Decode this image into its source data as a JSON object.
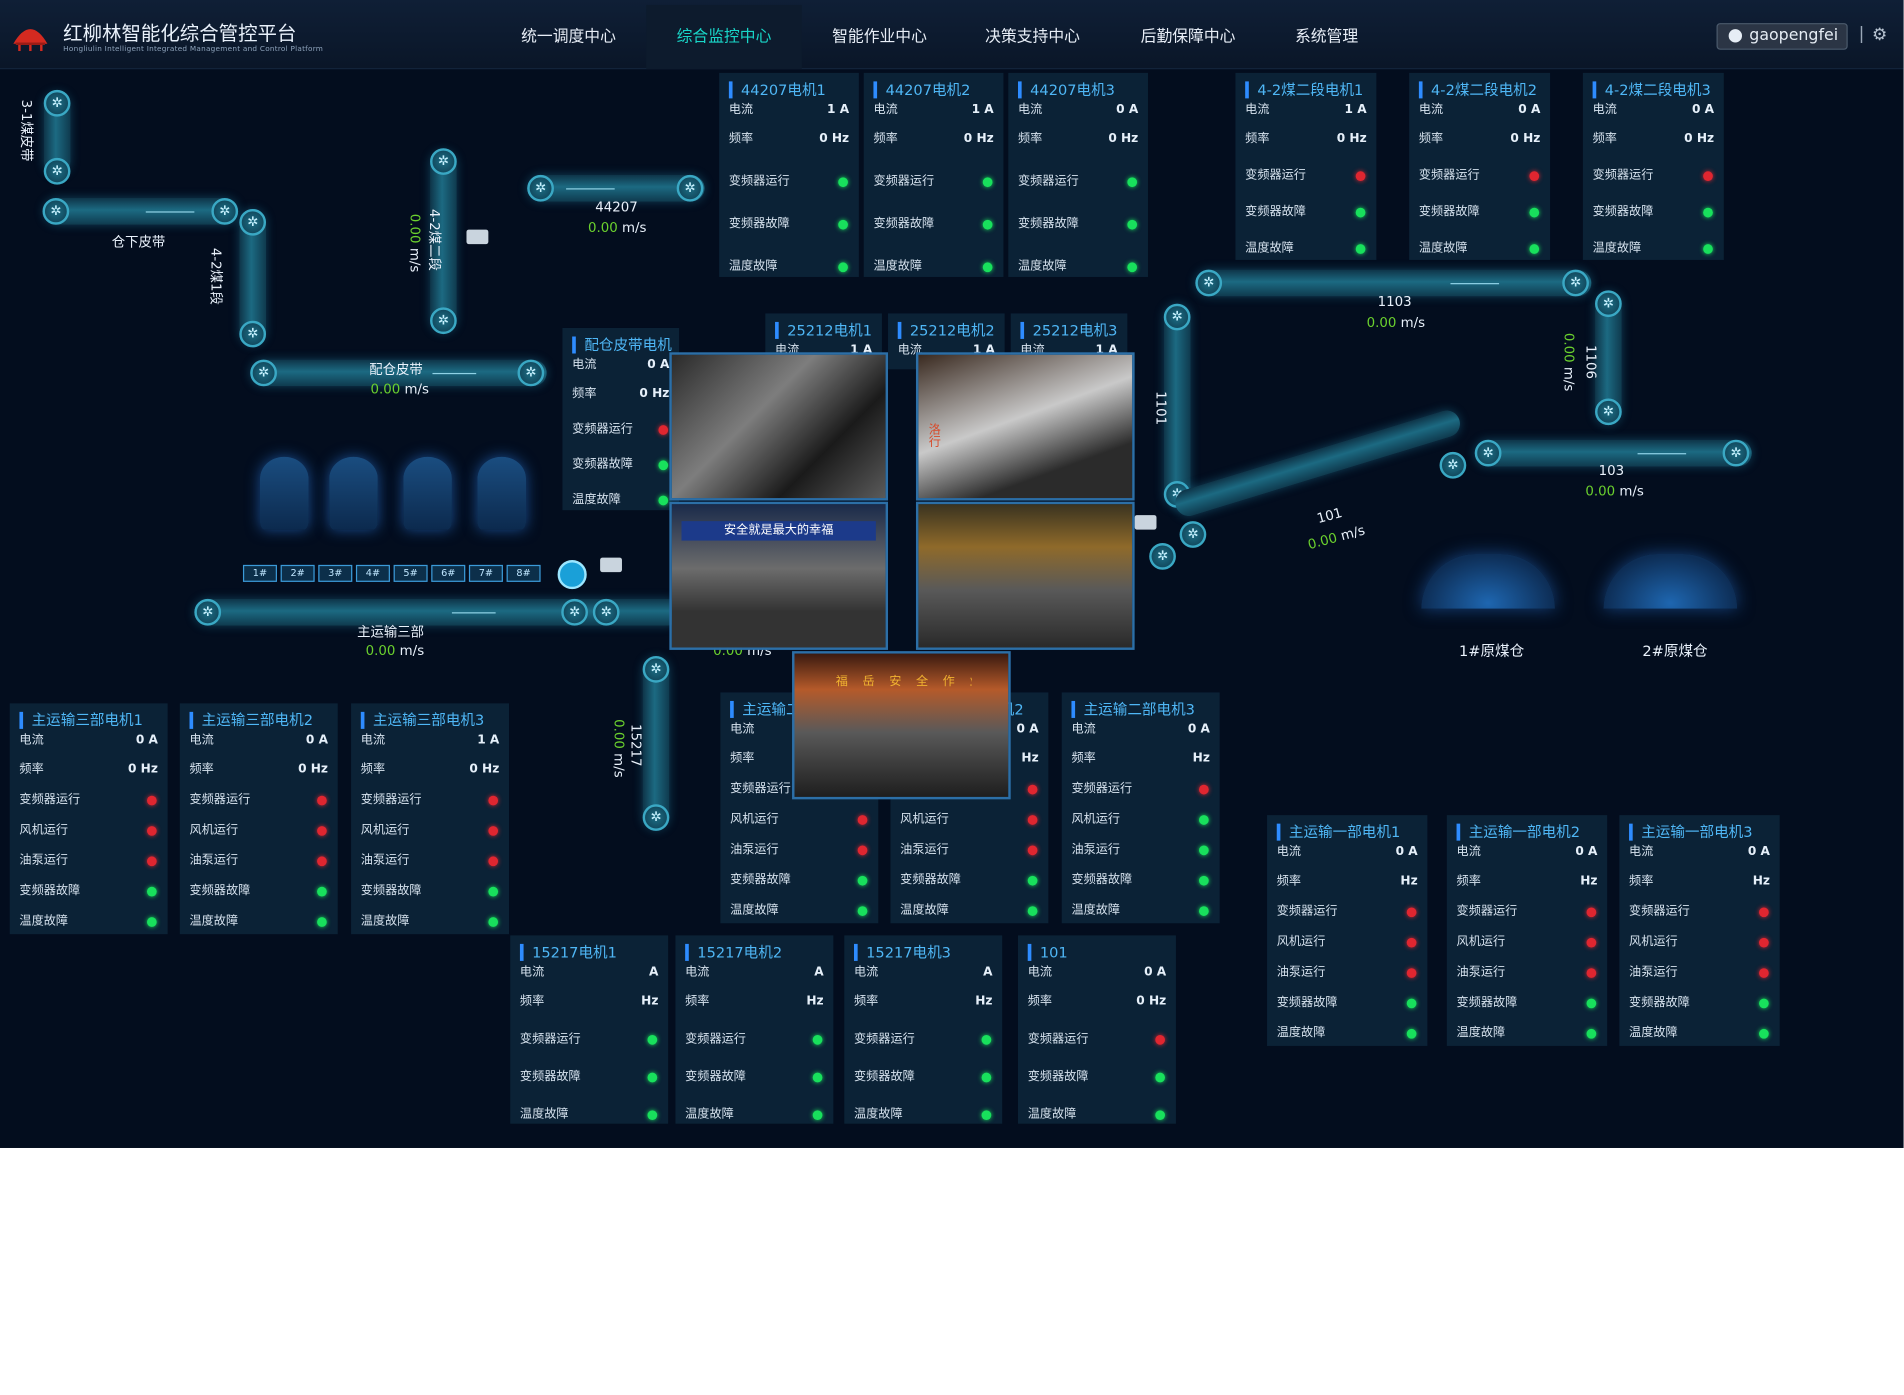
{
  "header": {
    "title": "红柳林智能化综合管控平台",
    "subtitle": "Hongliulin Intelligent Integrated Management and Control Platform",
    "nav": [
      {
        "label": "统一调度中心",
        "active": false
      },
      {
        "label": "综合监控中心",
        "active": true
      },
      {
        "label": "智能作业中心",
        "active": false
      },
      {
        "label": "决策支持中心",
        "active": false
      },
      {
        "label": "后勤保障中心",
        "active": false
      },
      {
        "label": "系统管理",
        "active": false
      }
    ],
    "user": "gaopengfei",
    "separator": "|",
    "settings_icon": "gear-icon"
  },
  "labels": {
    "current": "电流",
    "freq": "频率",
    "vfd_run": "变频器运行",
    "fan_run": "风机运行",
    "pump_run": "油泵运行",
    "vfd_fault": "变频器故障",
    "temp_fault": "温度故障"
  },
  "colors": {
    "ok": "#18e05c",
    "alarm": "#e02630",
    "accent": "#4fb7f6",
    "active_nav": "#19d6c8"
  },
  "belts": {
    "b31": {
      "label": "3-1煤皮带"
    },
    "cangxia": {
      "label": "仓下皮带"
    },
    "b421": {
      "label": "4-2煤1段"
    },
    "b422": {
      "label": "4-2煤二段",
      "speed": "0.00",
      "unit": "m/s"
    },
    "b44207": {
      "label": "44207",
      "speed": "0.00",
      "unit": "m/s"
    },
    "peicang": {
      "label": "配仓皮带",
      "speed": "0.00",
      "unit": "m/s"
    },
    "main3": {
      "label": "主运输三部",
      "speed": "0.00",
      "unit": "m/s"
    },
    "b15217": {
      "label": "15217",
      "speed": "0.00",
      "unit": "m/s"
    },
    "b1103": {
      "label": "1103",
      "speed": "0.00",
      "unit": "m/s"
    },
    "b1101": {
      "label": "1101",
      "speed": "0.00",
      "unit": "m/s"
    },
    "b1106": {
      "label": "1106",
      "speed": "0.00",
      "unit": "m/s"
    },
    "b103": {
      "label": "103",
      "speed": "0.00",
      "unit": "m/s"
    },
    "b101": {
      "label": "101",
      "speed": "0.00",
      "unit": "m/s"
    },
    "hidden_speed": {
      "speed": "0.00",
      "unit": "m/s"
    }
  },
  "bins": [
    "1#",
    "2#",
    "3#",
    "4#",
    "5#",
    "6#",
    "7#",
    "8#"
  ],
  "silos": {
    "s1": "1#原煤仓",
    "s2": "2#原煤仓"
  },
  "cards": [
    {
      "id": "c44207a",
      "title": "44207电机1",
      "current": "1 A",
      "freq": "0 Hz",
      "status": [
        [
          "vfd_run",
          "g"
        ],
        [
          "vfd_fault",
          "g"
        ],
        [
          "temp_fault",
          "g"
        ]
      ]
    },
    {
      "id": "c44207b",
      "title": "44207电机2",
      "current": "1 A",
      "freq": "0 Hz",
      "status": [
        [
          "vfd_run",
          "g"
        ],
        [
          "vfd_fault",
          "g"
        ],
        [
          "temp_fault",
          "g"
        ]
      ]
    },
    {
      "id": "c44207c",
      "title": "44207电机3",
      "current": "0 A",
      "freq": "0 Hz",
      "status": [
        [
          "vfd_run",
          "g"
        ],
        [
          "vfd_fault",
          "g"
        ],
        [
          "temp_fault",
          "g"
        ]
      ]
    },
    {
      "id": "c42a",
      "title": "4-2煤二段电机1",
      "current": "1 A",
      "freq": "0 Hz",
      "status": [
        [
          "vfd_run",
          "r"
        ],
        [
          "vfd_fault",
          "g"
        ],
        [
          "temp_fault",
          "g"
        ]
      ]
    },
    {
      "id": "c42b",
      "title": "4-2煤二段电机2",
      "current": "0 A",
      "freq": "0 Hz",
      "status": [
        [
          "vfd_run",
          "r"
        ],
        [
          "vfd_fault",
          "g"
        ],
        [
          "temp_fault",
          "g"
        ]
      ]
    },
    {
      "id": "c42c",
      "title": "4-2煤二段电机3",
      "current": "0 A",
      "freq": "0 Hz",
      "status": [
        [
          "vfd_run",
          "r"
        ],
        [
          "vfd_fault",
          "g"
        ],
        [
          "temp_fault",
          "g"
        ]
      ]
    },
    {
      "id": "cpc",
      "title": "配仓皮带电机",
      "current": "0 A",
      "freq": "0 Hz",
      "status": [
        [
          "vfd_run",
          "r"
        ],
        [
          "vfd_fault",
          "g"
        ],
        [
          "temp_fault",
          "g"
        ]
      ]
    },
    {
      "id": "c25a",
      "title": "25212电机1",
      "current": "1 A",
      "freq": "",
      "status": []
    },
    {
      "id": "c25b",
      "title": "25212电机2",
      "current": "1 A",
      "freq": "",
      "status": []
    },
    {
      "id": "c25c",
      "title": "25212电机3",
      "current": "1 A",
      "freq": "",
      "status": []
    },
    {
      "id": "cm3a",
      "title": "主运输三部电机1",
      "current": "0 A",
      "freq": "0 Hz",
      "status": [
        [
          "vfd_run",
          "r"
        ],
        [
          "fan_run",
          "r"
        ],
        [
          "pump_run",
          "r"
        ],
        [
          "vfd_fault",
          "g"
        ],
        [
          "temp_fault",
          "g"
        ]
      ]
    },
    {
      "id": "cm3b",
      "title": "主运输三部电机2",
      "current": "0 A",
      "freq": "0 Hz",
      "status": [
        [
          "vfd_run",
          "r"
        ],
        [
          "fan_run",
          "r"
        ],
        [
          "pump_run",
          "r"
        ],
        [
          "vfd_fault",
          "g"
        ],
        [
          "temp_fault",
          "g"
        ]
      ]
    },
    {
      "id": "cm3c",
      "title": "主运输三部电机3",
      "current": "1 A",
      "freq": "0 Hz",
      "status": [
        [
          "vfd_run",
          "r"
        ],
        [
          "fan_run",
          "r"
        ],
        [
          "pump_run",
          "r"
        ],
        [
          "vfd_fault",
          "g"
        ],
        [
          "temp_fault",
          "g"
        ]
      ]
    },
    {
      "id": "cm2a",
      "title": "主运输二部电机1",
      "current": "",
      "freq": "",
      "status": [
        [
          "vfd_run",
          "r"
        ],
        [
          "fan_run",
          "r"
        ],
        [
          "pump_run",
          "r"
        ],
        [
          "vfd_fault",
          "g"
        ],
        [
          "temp_fault",
          "g"
        ]
      ]
    },
    {
      "id": "cm2b",
      "title": "主运输二部电机2",
      "current": "0 A",
      "freq": "Hz",
      "status": [
        [
          "vfd_run",
          "r"
        ],
        [
          "fan_run",
          "r"
        ],
        [
          "pump_run",
          "r"
        ],
        [
          "vfd_fault",
          "g"
        ],
        [
          "temp_fault",
          "g"
        ]
      ]
    },
    {
      "id": "cm2c",
      "title": "主运输二部电机3",
      "current": "0 A",
      "freq": "Hz",
      "status": [
        [
          "vfd_run",
          "r"
        ],
        [
          "fan_run",
          "g"
        ],
        [
          "pump_run",
          "g"
        ],
        [
          "vfd_fault",
          "g"
        ],
        [
          "temp_fault",
          "g"
        ]
      ]
    },
    {
      "id": "cm1a",
      "title": "主运输一部电机1",
      "current": "0 A",
      "freq": "Hz",
      "status": [
        [
          "vfd_run",
          "r"
        ],
        [
          "fan_run",
          "r"
        ],
        [
          "pump_run",
          "r"
        ],
        [
          "vfd_fault",
          "g"
        ],
        [
          "temp_fault",
          "g"
        ]
      ]
    },
    {
      "id": "cm1b",
      "title": "主运输一部电机2",
      "current": "0 A",
      "freq": "Hz",
      "status": [
        [
          "vfd_run",
          "r"
        ],
        [
          "fan_run",
          "r"
        ],
        [
          "pump_run",
          "r"
        ],
        [
          "vfd_fault",
          "g"
        ],
        [
          "temp_fault",
          "g"
        ]
      ]
    },
    {
      "id": "cm1c",
      "title": "主运输一部电机3",
      "current": "0 A",
      "freq": "Hz",
      "status": [
        [
          "vfd_run",
          "r"
        ],
        [
          "fan_run",
          "r"
        ],
        [
          "pump_run",
          "r"
        ],
        [
          "vfd_fault",
          "g"
        ],
        [
          "temp_fault",
          "g"
        ]
      ]
    },
    {
      "id": "c15a",
      "title": "15217电机1",
      "current": "A",
      "freq": "Hz",
      "status": [
        [
          "vfd_run",
          "g"
        ],
        [
          "vfd_fault",
          "g"
        ],
        [
          "temp_fault",
          "g"
        ]
      ]
    },
    {
      "id": "c15b",
      "title": "15217电机2",
      "current": "A",
      "freq": "Hz",
      "status": [
        [
          "vfd_run",
          "g"
        ],
        [
          "vfd_fault",
          "g"
        ],
        [
          "temp_fault",
          "g"
        ]
      ]
    },
    {
      "id": "c15c",
      "title": "15217电机3",
      "current": "A",
      "freq": "Hz",
      "status": [
        [
          "vfd_run",
          "g"
        ],
        [
          "vfd_fault",
          "g"
        ],
        [
          "temp_fault",
          "g"
        ]
      ]
    },
    {
      "id": "c101",
      "title": "101",
      "current": "0 A",
      "freq": "0 Hz",
      "status": [
        [
          "vfd_run",
          "r"
        ],
        [
          "vfd_fault",
          "g"
        ],
        [
          "temp_fault",
          "g"
        ]
      ]
    }
  ],
  "videos": {
    "v1": {
      "caption": "",
      "overlay": ""
    },
    "v2": {
      "caption": "",
      "overlay": "洛行"
    },
    "v3": {
      "caption": "",
      "overlay": "安全就是最大的幸福"
    },
    "v4": {
      "caption": "",
      "overlay": ""
    },
    "v5": {
      "caption": "",
      "overlay": "福岳安全作业"
    }
  }
}
